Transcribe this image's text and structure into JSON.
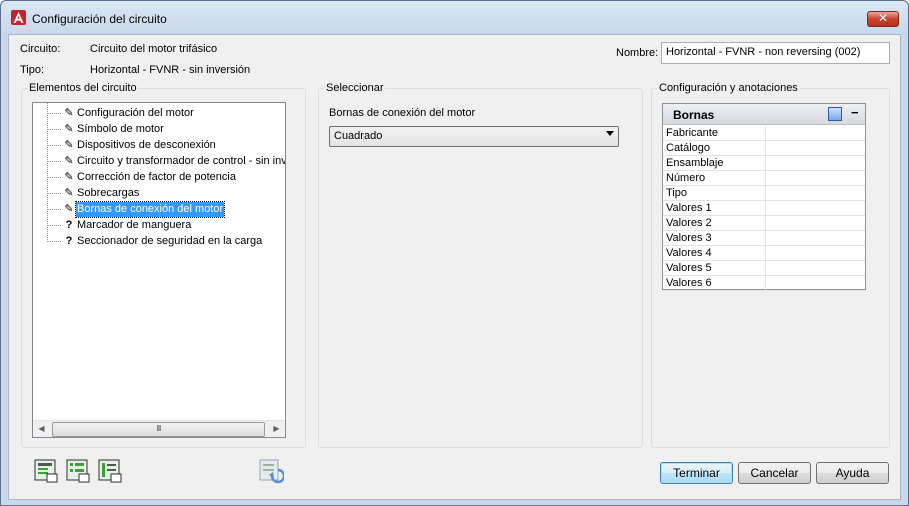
{
  "window": {
    "title": "Configuración del circuito",
    "close_glyph": "✕"
  },
  "info": {
    "circuit_label": "Circuito:",
    "circuit_value": "Circuito del motor trifásico",
    "type_label": "Tipo:",
    "type_value": "Horizontal - FVNR - sin inversión",
    "name_label": "Nombre:",
    "name_value": "Horizontal - FVNR - non reversing (002)"
  },
  "elements_panel": {
    "title": "Elementos del circuito",
    "items": [
      {
        "label": "Configuración del motor",
        "icon": "pencil-icon",
        "glyph": "✎",
        "selected": false
      },
      {
        "label": "Símbolo de motor",
        "icon": "pencil-icon",
        "glyph": "✎",
        "selected": false
      },
      {
        "label": "Dispositivos de desconexión",
        "icon": "pencil-icon",
        "glyph": "✎",
        "selected": false
      },
      {
        "label": "Circuito y transformador de control - sin inver",
        "icon": "pencil-icon",
        "glyph": "✎",
        "selected": false
      },
      {
        "label": "Corrección de factor de potencia",
        "icon": "pencil-icon",
        "glyph": "✎",
        "selected": false
      },
      {
        "label": "Sobrecargas",
        "icon": "pencil-icon",
        "glyph": "✎",
        "selected": false
      },
      {
        "label": "Bornas de conexión del motor",
        "icon": "pencil-icon",
        "glyph": "✎",
        "selected": true
      },
      {
        "label": "Marcador de manguera",
        "icon": "question-icon",
        "glyph": "?",
        "selected": false
      },
      {
        "label": "Seccionador de seguridad en la carga",
        "icon": "question-icon",
        "glyph": "?",
        "selected": false
      }
    ],
    "scroll_thumb_glyph": "III"
  },
  "select_panel": {
    "title": "Seleccionar",
    "field_label": "Bornas de conexión del motor",
    "combo_value": "Cuadrado"
  },
  "config_panel": {
    "title": "Configuración y anotaciones",
    "section_title": "Bornas",
    "collapse_glyph": "−",
    "rows": [
      {
        "name": "Fabricante",
        "value": ""
      },
      {
        "name": "Catálogo",
        "value": ""
      },
      {
        "name": "Ensamblaje",
        "value": ""
      },
      {
        "name": "Número",
        "value": ""
      },
      {
        "name": "Tipo",
        "value": ""
      },
      {
        "name": "Valores 1",
        "value": ""
      },
      {
        "name": "Valores 2",
        "value": ""
      },
      {
        "name": "Valores 3",
        "value": ""
      },
      {
        "name": "Valores 4",
        "value": ""
      },
      {
        "name": "Valores 5",
        "value": ""
      },
      {
        "name": "Valores 6",
        "value": ""
      }
    ]
  },
  "footer": {
    "finish_label": "Terminar",
    "cancel_label": "Cancelar",
    "help_label": "Ayuda"
  },
  "colors": {
    "selection": "#3399ff",
    "title_bar": "#c9d8ea",
    "close_button": "#c8432f",
    "tool_icon_green": "#3aa03a"
  }
}
